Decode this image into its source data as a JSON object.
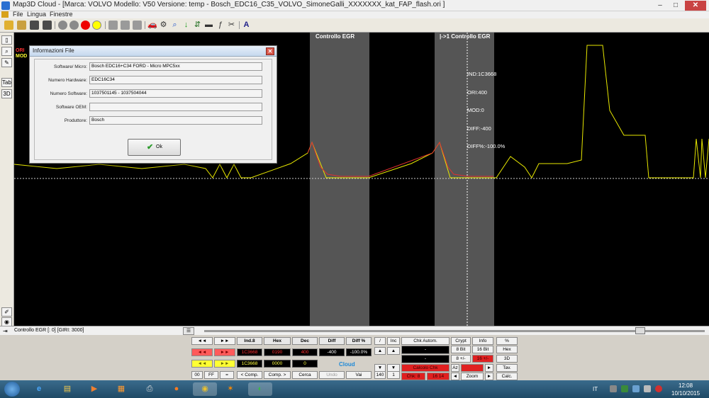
{
  "window": {
    "title": "Map3D Cloud - [Marca: VOLVO Modello: V50  Versione: temp - Bosch_EDC16_C35_VOLVO_SimoneGalli_XXXXXXX_kat_FAP_flash.ori ]",
    "minimize": "–",
    "maximize": "□",
    "close": "✕"
  },
  "menu": {
    "items": [
      "File",
      "Lingua",
      "Finestre"
    ]
  },
  "left_tools": {
    "tab": "Tab",
    "three_d": "3D"
  },
  "graph": {
    "band_labels": [
      "Controllo EGR",
      "|->1 Controllo EGR"
    ],
    "tooltip": [
      "IND:1C3668",
      "ORI:400",
      "MOD:0",
      "DIFF:-400",
      "DIFF%:-100.0%"
    ],
    "left_markers": [
      "ORI",
      "MOD"
    ],
    "colors": {
      "ori_line": "#e8e800",
      "mod_line": "#e03030",
      "band": "#555555",
      "background": "#000000"
    }
  },
  "dialog": {
    "title": "Informazioni File",
    "close": "✕",
    "fields": [
      {
        "label": "Software/ Micro:",
        "value": "Bosch EDC16+C34 FORD - Micro MPC5xx"
      },
      {
        "label": "Numero Hardware:",
        "value": "EDC16C34"
      },
      {
        "label": "Numero Software:",
        "value": "1037501145 - 1037504044"
      },
      {
        "label": "Software OEM:",
        "value": ""
      },
      {
        "label": "Produttore:",
        "value": "Bosch"
      }
    ],
    "ok_label": "Ok"
  },
  "statusbar": {
    "text": "Controllo EGR [: 0] [GIRI: 3000]",
    "button": "☰"
  },
  "panel": {
    "nav": {
      "rewind": "◄◄",
      "forward": "►►"
    },
    "headers": [
      "Ind.8",
      "Hex",
      "Dec",
      "Diff",
      "Diff %"
    ],
    "row_red": {
      "index": "1C3668",
      "hex": "0190",
      "dec": "400",
      "diff": "-400",
      "diff_pct": "-100.0%"
    },
    "row_yellow": {
      "index": "1C3668",
      "hex": "0000",
      "dec": "0"
    },
    "bottom_buttons": [
      "00",
      "FF",
      "=",
      "< Comp.",
      "Comp. >",
      "Cerca",
      "Undo",
      "Vai"
    ],
    "cloud": "Cloud",
    "slash": "/",
    "inc": "Inc",
    "up": "▲",
    "down": "▼",
    "inc_value": "140",
    "inc_value2": "1",
    "chk_autom": "Chk Autom.",
    "chk_line1": "-",
    "chk_line2": "-",
    "calcolo_chk": "Calcolo Chk",
    "chk_label": "Chk: 8",
    "chk_value": "16 14",
    "az": "Az",
    "crypt": "Crypt",
    "info": "Info",
    "bit8": "8 Bit",
    "bit16": "16 Bit",
    "plusminus": "8 +/-",
    "sign_value": "16 +/-",
    "zoom": "Zoom",
    "percent": "%",
    "hex": "Hex",
    "three_d": "3D",
    "tav": "Tav.",
    "calc": "Calc.",
    "small_left": "◄",
    "small_right": "►"
  },
  "taskbar": {
    "lang": "IT",
    "time": "12:08",
    "date": "10/10/2015"
  }
}
